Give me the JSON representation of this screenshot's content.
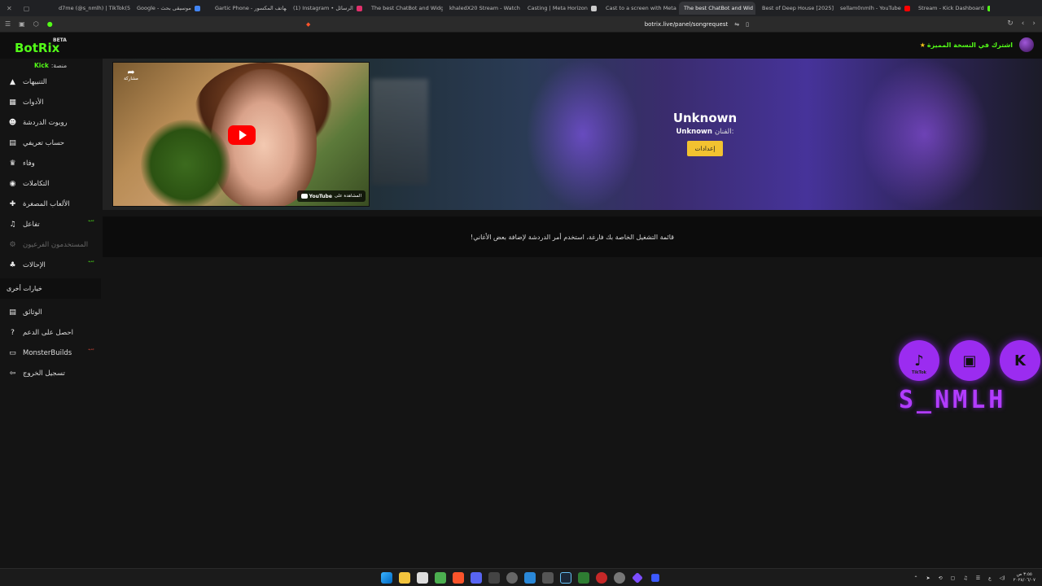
{
  "browser": {
    "tabs": [
      {
        "label": "d7me (@s_nmlh) | TikTok(5)",
        "color": "#25f4ee"
      },
      {
        "label": "Google - موسيقى بحث",
        "color": "#4285f4"
      },
      {
        "label": "Gartic Phone - الهاتف المكسور",
        "color": "#c55aff"
      },
      {
        "label": "(1) Instagram • الرسائل",
        "color": "#e1306c"
      },
      {
        "label": "The best ChatBot and Widg",
        "color": "#ffffff"
      },
      {
        "label": "khaledX20 Stream - Watch",
        "color": "#53fc18"
      },
      {
        "label": "Casting | Meta Horizon",
        "color": "#cccccc"
      },
      {
        "label": "Cast to a screen with Meta",
        "color": "#1877f2"
      },
      {
        "label": "The best ChatBot and Wid",
        "color": "#ffffff",
        "active": true
      },
      {
        "label": "Best of Deep House [2025]",
        "color": "#ff0000"
      },
      {
        "label": "sellam0nmlh - YouTube",
        "color": "#ff0000"
      },
      {
        "label": "Stream - Kick Dashboard",
        "color": "#53fc18"
      }
    ],
    "url": "botrix.live/panel/songrequest"
  },
  "app": {
    "logo": "BotRix",
    "beta": "BETA",
    "platform_label": "منصة:",
    "platform_value": "Kick",
    "premium_label": "اشترك في النسخة المميزة",
    "premium_icon": "star-icon"
  },
  "sidebar": {
    "items": [
      {
        "label": "التنبيهات",
        "icon": "alert-icon",
        "glyph": "▲"
      },
      {
        "label": "الأدوات",
        "icon": "tools-icon",
        "glyph": "▦"
      },
      {
        "label": "روبوت الدردشة",
        "icon": "robot-icon",
        "glyph": "☻"
      },
      {
        "label": "حساب تعريفي",
        "icon": "id-card-icon",
        "glyph": "▤"
      },
      {
        "label": "وفاء",
        "icon": "trophy-icon",
        "glyph": "♛"
      },
      {
        "label": "التكاملات",
        "icon": "integrations-icon",
        "glyph": "◉"
      },
      {
        "label": "الألعاب المصغرة",
        "icon": "gamepad-icon",
        "glyph": "✚"
      },
      {
        "label": "تفاعل",
        "icon": "music-icon",
        "glyph": "♫",
        "tag": "جديد"
      },
      {
        "label": "المستخدمون الفرعيون",
        "icon": "subusers-icon",
        "glyph": "⚙",
        "dim": true
      },
      {
        "label": "الإحالات",
        "icon": "users-icon",
        "glyph": "♣",
        "tag": "جديد"
      }
    ],
    "group_label": "خيارات أخرى",
    "other_items": [
      {
        "label": "الوثائق",
        "icon": "docs-icon",
        "glyph": "▤"
      },
      {
        "label": "احصل على الدعم",
        "icon": "help-icon",
        "glyph": "?"
      },
      {
        "label": "MonsterBuilds",
        "icon": "monitor-icon",
        "glyph": "▭",
        "hot": "جديد"
      },
      {
        "label": "تسجيل الخروج",
        "icon": "logout-icon",
        "glyph": "⇦"
      }
    ]
  },
  "player": {
    "share_label": "مشاركة",
    "watch_on": "المشاهدة على",
    "youtube": "YouTube",
    "song_title": "Unknown",
    "artist_label": "الفنان:",
    "artist_value": "Unknown",
    "settings_label": "إعدادات"
  },
  "queue": {
    "empty_message": "قائمة التشغيل الخاصة بك فارغة، استخدم أمر الدردشة لإضافة بعض الأغاني!"
  },
  "overlay": {
    "brand_name": "S_NMLH",
    "socials": [
      {
        "name": "tiktok-icon",
        "glyph": "♪",
        "caption": "TikTok"
      },
      {
        "name": "twitch-icon",
        "glyph": "▣",
        "caption": ""
      },
      {
        "name": "kick-icon",
        "glyph": "K",
        "caption": ""
      }
    ]
  },
  "taskbar": {
    "time": "٣:٥٥ ص",
    "date": "٢٠٢٨/٠٦/٠٧"
  }
}
